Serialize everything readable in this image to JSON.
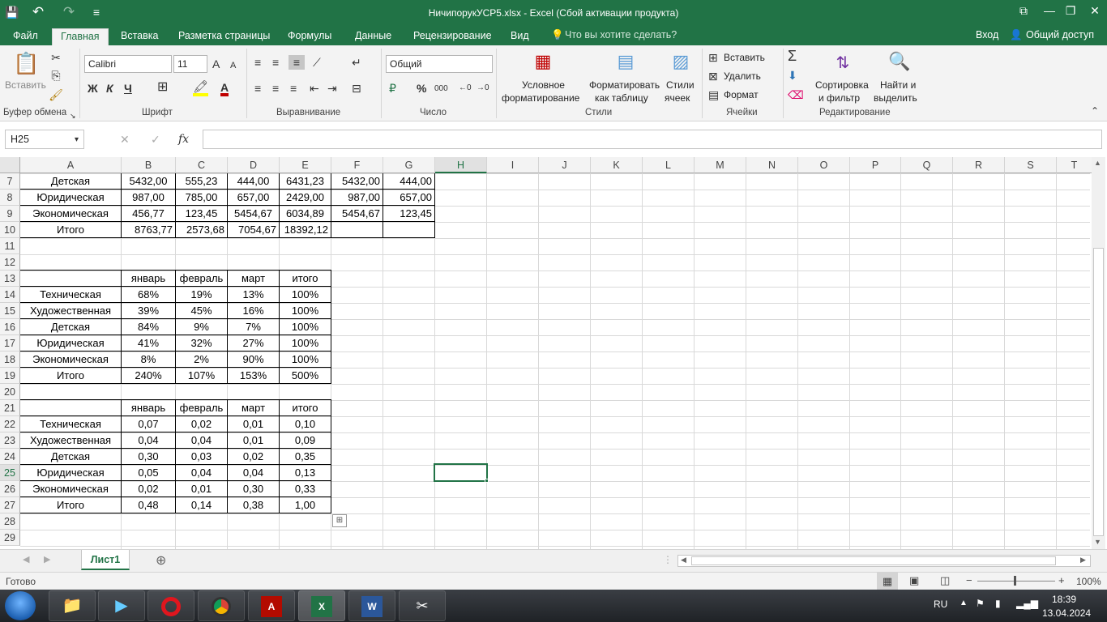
{
  "window": {
    "title": "НичипорукУСР5.xlsx - Excel (Сбой активации продукта)",
    "qat": {
      "save": "💾",
      "undo": "↶",
      "redo": "↷",
      "more": "≡"
    },
    "controls": {
      "restore_ribbon": "⧉",
      "minimize": "—",
      "maximize": "❐",
      "close": "✕"
    }
  },
  "tabs": {
    "file": "Файл",
    "home": "Главная",
    "insert": "Вставка",
    "layout": "Разметка страницы",
    "formulas": "Формулы",
    "data": "Данные",
    "review": "Рецензирование",
    "view": "Вид",
    "tell_me": "Что вы хотите сделать?",
    "signin": "Вход",
    "share": "Общий доступ"
  },
  "ribbon": {
    "clipboard": {
      "paste": "Вставить",
      "label": "Буфер обмена"
    },
    "font": {
      "name": "Calibri",
      "size": "11",
      "bold": "Ж",
      "italic": "К",
      "underline": "Ч",
      "grow": "A",
      "shrink": "A",
      "fontcolor": "A",
      "label": "Шрифт"
    },
    "alignment": {
      "label": "Выравнивание"
    },
    "number": {
      "format": "Общий",
      "percent": "%",
      "thousands": "000",
      "label": "Число"
    },
    "styles": {
      "conditional": [
        "Условное",
        "форматирование"
      ],
      "table": [
        "Форматировать",
        "как таблицу"
      ],
      "cellstyles": [
        "Стили",
        "ячеек"
      ],
      "label": "Стили"
    },
    "cells": {
      "insert": "Вставить",
      "delete": "Удалить",
      "format": "Формат",
      "label": "Ячейки"
    },
    "editing": {
      "sort": [
        "Сортировка",
        "и фильтр"
      ],
      "find": [
        "Найти и",
        "выделить"
      ],
      "label": "Редактирование"
    }
  },
  "formula_bar": {
    "name_box": "H25",
    "fx": "fx",
    "cancel": "✕",
    "enter": "✓",
    "formula": ""
  },
  "columns": [
    "A",
    "B",
    "C",
    "D",
    "E",
    "F",
    "G",
    "H",
    "I",
    "J",
    "K",
    "L",
    "M",
    "N",
    "O",
    "P",
    "Q",
    "R",
    "S",
    "T"
  ],
  "selected_column": "H",
  "rows": [
    "7",
    "8",
    "9",
    "10",
    "11",
    "12",
    "13",
    "14",
    "15",
    "16",
    "17",
    "18",
    "19",
    "20",
    "21",
    "22",
    "23",
    "24",
    "25",
    "26",
    "27",
    "28",
    "29"
  ],
  "selected_row": "25",
  "table1": [
    [
      "Детская",
      "5432,00",
      "555,23",
      "444,00",
      "6431,23",
      "5432,00",
      "444,00"
    ],
    [
      "Юридическая",
      "987,00",
      "785,00",
      "657,00",
      "2429,00",
      "987,00",
      "657,00"
    ],
    [
      "Экономическая",
      "456,77",
      "123,45",
      "5454,67",
      "6034,89",
      "5454,67",
      "123,45"
    ],
    [
      "Итого",
      "8763,77",
      "2573,68",
      "7054,67",
      "18392,12",
      "",
      ""
    ]
  ],
  "table2": {
    "header": [
      "",
      "январь",
      "февраль",
      "март",
      "итого"
    ],
    "rows": [
      [
        "Техническая",
        "68%",
        "19%",
        "13%",
        "100%"
      ],
      [
        "Художественная",
        "39%",
        "45%",
        "16%",
        "100%"
      ],
      [
        "Детская",
        "84%",
        "9%",
        "7%",
        "100%"
      ],
      [
        "Юридическая",
        "41%",
        "32%",
        "27%",
        "100%"
      ],
      [
        "Экономическая",
        "8%",
        "2%",
        "90%",
        "100%"
      ],
      [
        "Итого",
        "240%",
        "107%",
        "153%",
        "500%"
      ]
    ]
  },
  "table3": {
    "header": [
      "",
      "январь",
      "февраль",
      "март",
      "итого"
    ],
    "rows": [
      [
        "Техническая",
        "0,07",
        "0,02",
        "0,01",
        "0,10"
      ],
      [
        "Художественная",
        "0,04",
        "0,04",
        "0,01",
        "0,09"
      ],
      [
        "Детская",
        "0,30",
        "0,03",
        "0,02",
        "0,35"
      ],
      [
        "Юридическая",
        "0,05",
        "0,04",
        "0,04",
        "0,13"
      ],
      [
        "Экономическая",
        "0,02",
        "0,01",
        "0,30",
        "0,33"
      ],
      [
        "Итого",
        "0,48",
        "0,14",
        "0,38",
        "1,00"
      ]
    ]
  },
  "sheets": {
    "active": "Лист1",
    "add": "⊕"
  },
  "status": {
    "ready": "Готово",
    "zoom": "100%",
    "minus": "−",
    "plus": "+"
  },
  "taskbar": {
    "lang": "RU",
    "time": "18:39",
    "date": "13.04.2024"
  }
}
